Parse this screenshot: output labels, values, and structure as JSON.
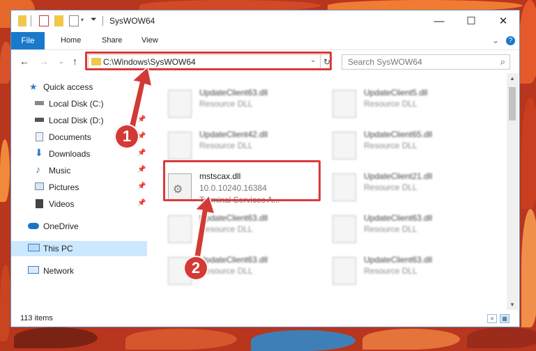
{
  "window": {
    "title": "SysWOW64"
  },
  "window_controls": {
    "minimize": "—",
    "maximize": "☐",
    "close": "✕"
  },
  "ribbon": {
    "file": "File",
    "tabs": [
      "Home",
      "Share",
      "View"
    ]
  },
  "address": {
    "path": "C:\\Windows\\SysWOW64",
    "search_placeholder": "Search SysWOW64"
  },
  "nav": {
    "quick_access": "Quick access",
    "items": [
      {
        "label": "Local Disk (C:)",
        "icon": "drive-icon",
        "pinned": false
      },
      {
        "label": "Local Disk (D:)",
        "icon": "drive-icon",
        "pinned": true
      },
      {
        "label": "Documents",
        "icon": "documents-icon",
        "pinned": true
      },
      {
        "label": "Downloads",
        "icon": "downloads-icon",
        "pinned": true
      },
      {
        "label": "Music",
        "icon": "music-icon",
        "pinned": true
      },
      {
        "label": "Pictures",
        "icon": "pictures-icon",
        "pinned": true
      },
      {
        "label": "Videos",
        "icon": "videos-icon",
        "pinned": true
      }
    ],
    "onedrive": "OneDrive",
    "this_pc": "This PC",
    "network": "Network"
  },
  "files": {
    "col1": [
      {
        "name": "UpdateClient63.dll",
        "type": "Resource DLL"
      },
      {
        "name": "UpdateClient42.dll",
        "type": "Resource DLL"
      },
      {
        "name": "mstscax.dll",
        "version": "10.0.10240.16384",
        "description": "Terminal Services A..."
      },
      {
        "name": "UpdateClient63.dll",
        "type": "Resource DLL"
      },
      {
        "name": "UpdateClient63.dll",
        "type": "Resource DLL"
      }
    ],
    "col2": [
      {
        "name": "UpdateClient5.dll",
        "type": "Resource DLL"
      },
      {
        "name": "UpdateClient65.dll",
        "type": "Resource DLL"
      },
      {
        "name": "UpdateClient21.dll",
        "type": "Resource DLL"
      },
      {
        "name": "UpdateClient63.dll",
        "type": "Resource DLL"
      },
      {
        "name": "UpdateClient63.dll",
        "type": "Resource DLL"
      }
    ]
  },
  "status": {
    "count": "113 items"
  },
  "callouts": [
    "1",
    "2"
  ],
  "colors": {
    "accent": "#1979ca",
    "highlight": "#d93a3a",
    "selected": "#cce8ff"
  }
}
